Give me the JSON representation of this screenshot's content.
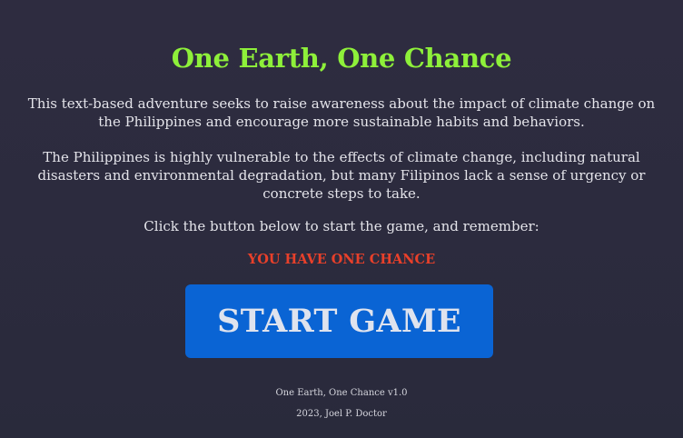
{
  "game": {
    "title": "One Earth, One Chance",
    "intro_paragraph": "This text-based adventure seeks to raise awareness about the impact of climate change on the Philippines and encourage more sustainable habits and behaviors.",
    "context_paragraph": "The Philippines is highly vulnerable to the effects of climate change, including natural disasters and environmental degradation, but many Filipinos lack a sense of urgency or concrete steps to take.",
    "instruction": "Click the button below to start the game, and remember:",
    "warning": "YOU HAVE ONE CHANCE",
    "start_button_label": "START GAME"
  },
  "footer": {
    "version": "One Earth, One Chance v1.0",
    "credit": "2023, Joel P. Doctor"
  },
  "colors": {
    "background": "#2d2c3f",
    "title": "#8ef03a",
    "warning": "#e8402a",
    "button": "#0a64d4",
    "text": "#e4e4ea"
  }
}
